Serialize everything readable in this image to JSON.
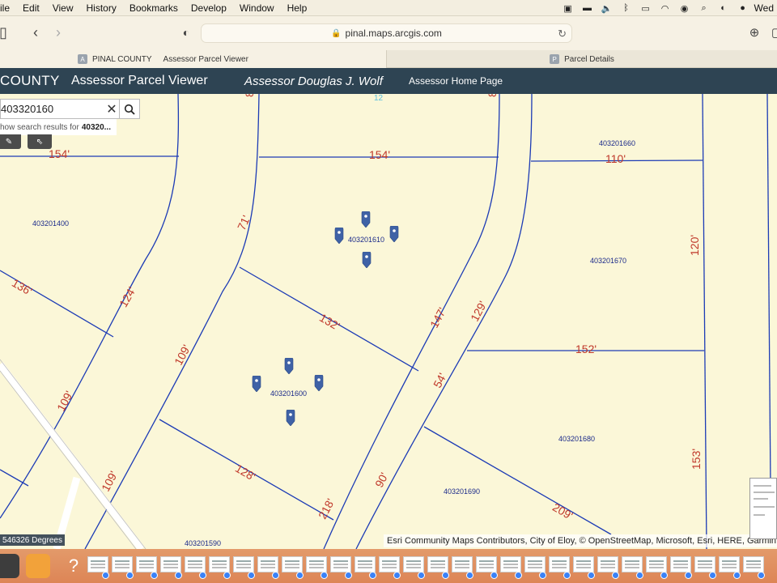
{
  "menubar": {
    "items": [
      "ile",
      "Edit",
      "View",
      "History",
      "Bookmarks",
      "Develop",
      "Window",
      "Help"
    ],
    "clock": "Wed",
    "status_icons": [
      "screen-mirror-icon",
      "display-icon",
      "volume-icon",
      "bluetooth-icon",
      "battery-icon",
      "wifi-icon",
      "user-icon",
      "search-icon",
      "control-center-icon",
      "siri-icon"
    ]
  },
  "browser": {
    "url": "pinal.maps.arcgis.com",
    "tabs": [
      {
        "favicon": "A",
        "title": "PINAL COUNTY",
        "subtitle": "Assessor Parcel Viewer",
        "active": true
      },
      {
        "favicon": "P",
        "title": "Parcel Details",
        "active": false
      }
    ]
  },
  "app_header": {
    "county": "COUNTY",
    "viewer_title": "Assessor Parcel Viewer",
    "assessor": "Assessor Douglas J. Wolf",
    "home_link": "Assessor Home Page"
  },
  "search": {
    "value": "403320160",
    "suggestion_prefix": "how search results for",
    "suggestion_term": "40320..."
  },
  "map": {
    "parcel_ids": [
      "403201400",
      "403201610",
      "403201600",
      "403201660",
      "403201670",
      "403201680",
      "403201690",
      "403201590"
    ],
    "dimension_labels": [
      "154'",
      "154'",
      "110'",
      "71'",
      "136'",
      "124'",
      "132'",
      "147'",
      "129'",
      "120'",
      "152'",
      "109'",
      "54'",
      "109'",
      "128'",
      "90'",
      "218'",
      "209'",
      "153'",
      "109'",
      "8",
      "8",
      "12"
    ],
    "coordinates_text": "546326 Degrees",
    "attribution": "Esri Community Maps Contributors, City of Eloy, © OpenStreetMap, Microsoft, Esri, HERE, Garmin, Safe"
  },
  "colors": {
    "header_bg": "#2e4453",
    "parcel_fill": "#fbf7d8",
    "parcel_line": "#1c3bb5",
    "dimension_text": "#c0392b",
    "marker": "#3f62a6",
    "dock": "#e0905f"
  },
  "dock": {
    "icons": [
      "finder-icon",
      "pencil-app-icon",
      "help-icon"
    ],
    "window_count": 28
  }
}
